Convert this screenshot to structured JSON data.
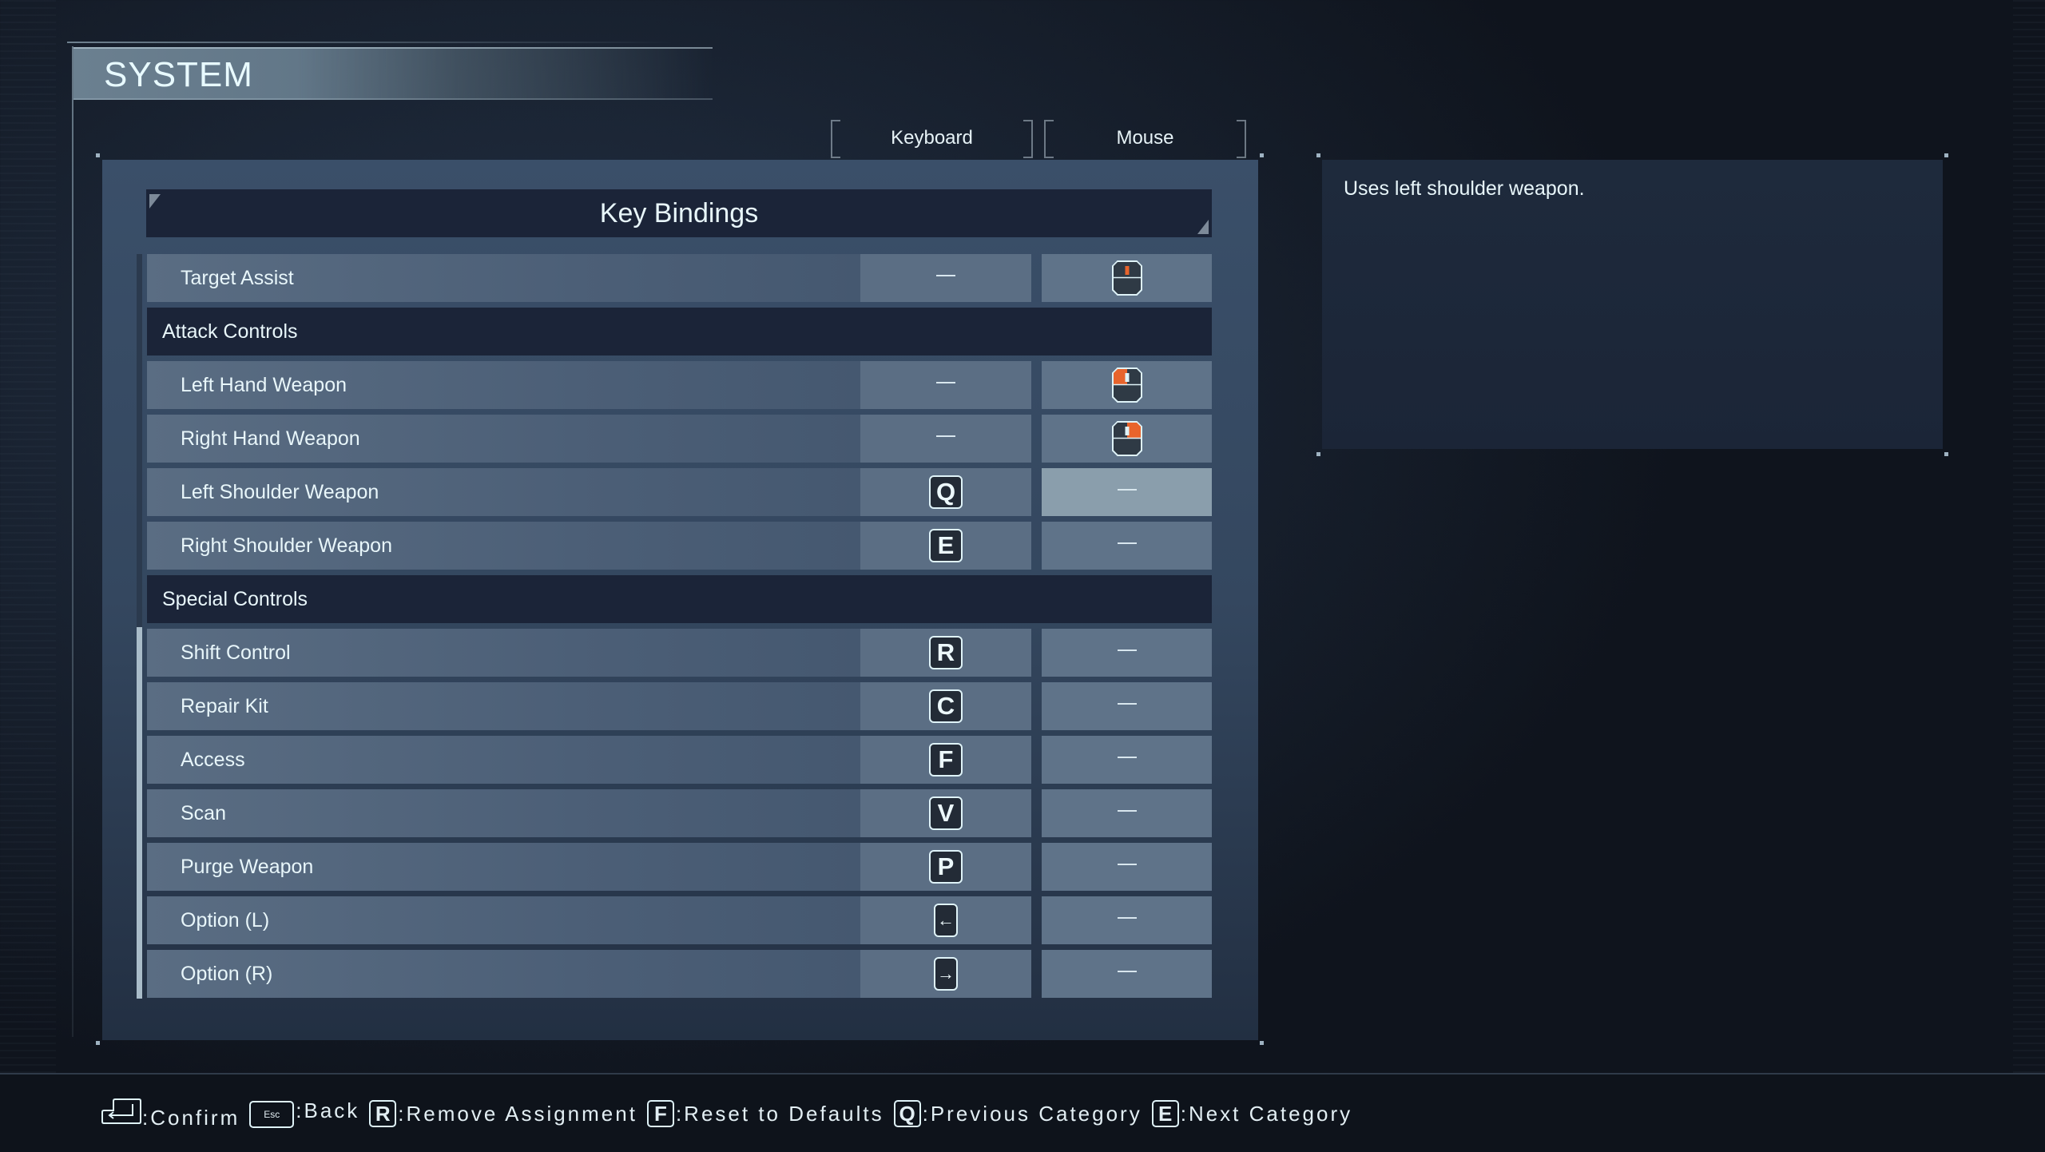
{
  "header": {
    "title": "SYSTEM"
  },
  "tabs": [
    {
      "label": "Keyboard",
      "active": true
    },
    {
      "label": "Mouse",
      "active": false
    }
  ],
  "panel": {
    "title": "Key Bindings"
  },
  "bindings": [
    {
      "type": "row",
      "label": "Target Assist",
      "key": null,
      "mouse": "mouse-middle-button"
    },
    {
      "type": "category",
      "label": "Attack Controls"
    },
    {
      "type": "row",
      "label": "Left Hand Weapon",
      "key": null,
      "mouse": "mouse-left-button"
    },
    {
      "type": "row",
      "label": "Right Hand Weapon",
      "key": null,
      "mouse": "mouse-right-button"
    },
    {
      "type": "row",
      "label": "Left Shoulder Weapon",
      "key": "Q",
      "mouse": null,
      "selected": true
    },
    {
      "type": "row",
      "label": "Right Shoulder Weapon",
      "key": "E",
      "mouse": null
    },
    {
      "type": "category",
      "label": "Special Controls"
    },
    {
      "type": "row",
      "label": "Shift Control",
      "key": "R",
      "mouse": null
    },
    {
      "type": "row",
      "label": "Repair Kit",
      "key": "C",
      "mouse": null
    },
    {
      "type": "row",
      "label": "Access",
      "key": "F",
      "mouse": null
    },
    {
      "type": "row",
      "label": "Scan",
      "key": "V",
      "mouse": null
    },
    {
      "type": "row",
      "label": "Purge Weapon",
      "key": "P",
      "mouse": null
    },
    {
      "type": "row",
      "label": "Option (L)",
      "key": "←",
      "mouse": null
    },
    {
      "type": "row",
      "label": "Option (R)",
      "key": "→",
      "mouse": null
    }
  ],
  "unassigned_symbol": "—",
  "description": "Uses left shoulder weapon.",
  "colors": {
    "accent_orange": "#e8642c",
    "category_bg": "#1b2438",
    "selected_cell": "#8a9eac"
  },
  "footer": [
    {
      "key": "Enter",
      "icon": "enter-key-icon",
      "label": ":Confirm"
    },
    {
      "key": "Esc",
      "label": ":Back"
    },
    {
      "key": "R",
      "label": ":Remove Assignment"
    },
    {
      "key": "F",
      "label": ":Reset to Defaults"
    },
    {
      "key": "Q",
      "label": ":Previous Category"
    },
    {
      "key": "E",
      "label": ":Next Category"
    }
  ]
}
